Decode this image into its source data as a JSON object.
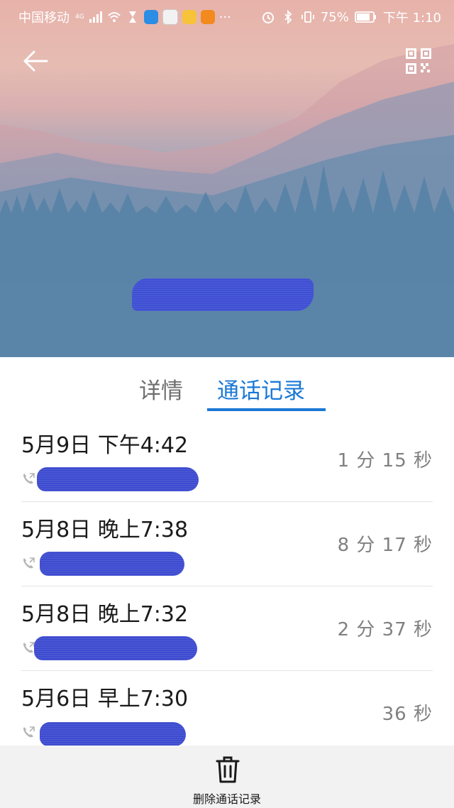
{
  "status_bar": {
    "carrier": "中国移动",
    "network": "4G",
    "battery": "75%",
    "time": "下午 1:10",
    "more": "···"
  },
  "header": {
    "contact_name": "​"
  },
  "tabs": [
    {
      "label": "详情",
      "active": false
    },
    {
      "label": "通话记录",
      "active": true
    }
  ],
  "calls": [
    {
      "datetime": "5月9日 下午4:42",
      "duration": "1 分 15 秒"
    },
    {
      "datetime": "5月8日 晚上7:38",
      "duration": "8 分 17 秒"
    },
    {
      "datetime": "5月8日 晚上7:32",
      "duration": "2 分 37 秒"
    },
    {
      "datetime": "5月6日 早上7:30",
      "duration": "36 秒"
    }
  ],
  "footer": {
    "delete_label": "删除通话记录"
  },
  "colors": {
    "accent": "#1b78d6",
    "redaction": "#3f4fd3"
  },
  "icons": [
    "back-arrow-icon",
    "qr-code-icon",
    "outgoing-call-icon",
    "trash-icon"
  ]
}
